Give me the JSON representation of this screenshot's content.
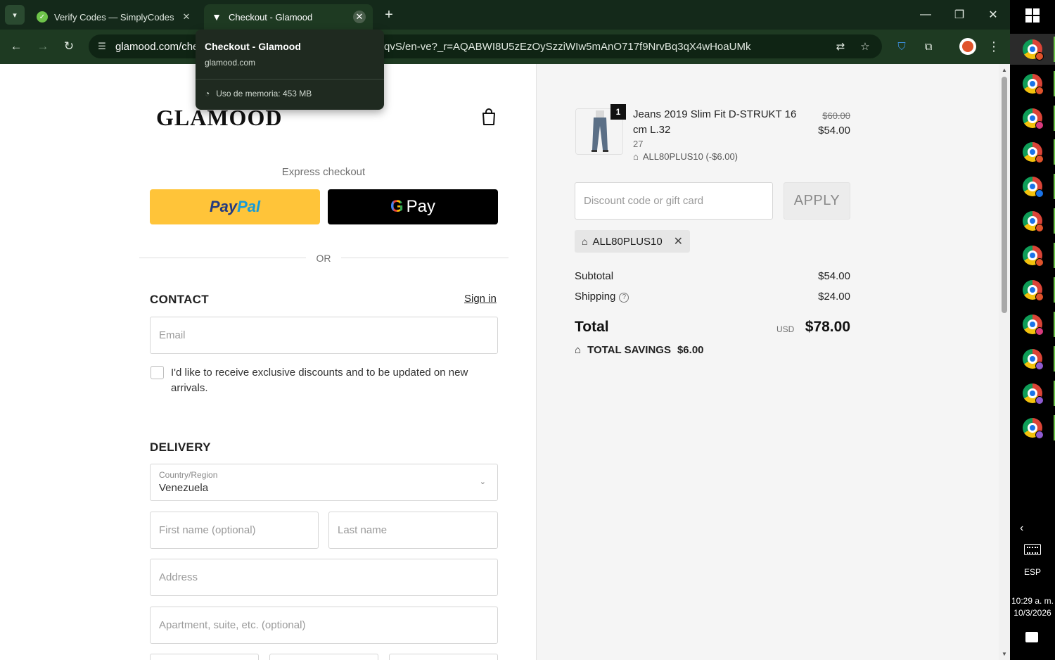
{
  "browser": {
    "tabs": [
      {
        "title": "Verify Codes — SimplyCodes",
        "active": false
      },
      {
        "title": "Checkout - Glamood",
        "active": true
      }
    ],
    "url_left": "glamood.com/che",
    "url_right": "qvS/en-ve?_r=AQABWI8U5zEzOySzziWIw5mAnO717f9NrvBq3qX4wHoaUMk",
    "tooltip": {
      "title": "Checkout - Glamood",
      "host": "glamood.com",
      "memory": "Uso de memoria: 453 MB"
    }
  },
  "shop": {
    "logo": "GLAMOOD",
    "express_checkout": "Express checkout",
    "paypal_a": "Pay",
    "paypal_b": "Pal",
    "gpay_g": "G",
    "gpay_text": "Pay",
    "or": "OR"
  },
  "contact": {
    "title": "CONTACT",
    "sign_in": "Sign in",
    "email_placeholder": "Email",
    "newsletter_label": "I'd like to receive exclusive discounts and to be updated on new arrivals."
  },
  "delivery": {
    "title": "DELIVERY",
    "country_label": "Country/Region",
    "country_value": "Venezuela",
    "first_name_placeholder": "First name (optional)",
    "last_name_placeholder": "Last name",
    "address_placeholder": "Address",
    "apartment_placeholder": "Apartment, suite, etc. (optional)"
  },
  "order": {
    "item": {
      "quantity": "1",
      "name": "Jeans 2019 Slim Fit D-STRUKT 16 cm L.32",
      "variant": "27",
      "discount": "ALL80PLUS10 (-$6.00)",
      "price_original": "$60.00",
      "price_final": "$54.00"
    },
    "discount_placeholder": "Discount code or gift card",
    "apply_label": "APPLY",
    "applied_code": "ALL80PLUS10",
    "subtotal_label": "Subtotal",
    "subtotal_value": "$54.00",
    "shipping_label": "Shipping",
    "shipping_value": "$24.00",
    "total_label": "Total",
    "currency": "USD",
    "total_value": "$78.00",
    "savings_label": "TOTAL SAVINGS",
    "savings_value": "$6.00"
  },
  "taskbar": {
    "language": "ESP",
    "time": "10:29 a. m.",
    "date": "10/3/2026"
  },
  "colors": {
    "chrome_bg": "#1e3a22",
    "paypal_yellow": "#ffc439",
    "right_pane_bg": "#f5f5f5"
  }
}
